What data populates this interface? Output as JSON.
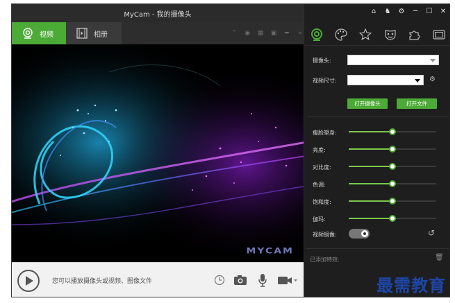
{
  "window": {
    "title": "MyCam - 我的摄像头"
  },
  "tabs": [
    {
      "label": "视频",
      "icon": "webcam-icon",
      "active": true
    },
    {
      "label": "相册",
      "icon": "film-icon",
      "active": false
    }
  ],
  "toolbar_icons": [
    "collapse-icon",
    "broadcast-icon",
    "grid-icon",
    "lock-icon",
    "share-icon",
    "chevron-left-icon"
  ],
  "preview": {
    "watermark": "MYCAM"
  },
  "bottom": {
    "hint": "您可以播放摄像头或视频、图像文件",
    "icons": [
      "play-icon",
      "timer-icon",
      "camera-icon",
      "microphone-icon",
      "video-camera-icon"
    ]
  },
  "window_controls": [
    "home-icon",
    "shirt-icon",
    "gear-icon",
    "minimize-icon",
    "maximize-icon",
    "close-icon"
  ],
  "feature_tabs": [
    "webcam-tab-icon",
    "palette-icon",
    "star-effects-icon",
    "mask-icon",
    "puzzle-icon",
    "frame-icon"
  ],
  "settings": {
    "camera_label": "摄像头:",
    "camera_value": "",
    "size_label": "视频尺寸:",
    "size_value": "",
    "open_camera": "打开摄像头",
    "open_file": "打开文件"
  },
  "adjustments": [
    {
      "label": "瘦脸塑身:",
      "value": 0.5
    },
    {
      "label": "亮度:",
      "value": 0.5
    },
    {
      "label": "对比度:",
      "value": 0.5
    },
    {
      "label": "色调:",
      "value": 0.5
    },
    {
      "label": "饱和度:",
      "value": 0.5
    },
    {
      "label": "伽玛:",
      "value": 0.5
    }
  ],
  "mirror": {
    "label": "视频镜像:",
    "on": true
  },
  "effects": {
    "label": "已添加特效:"
  },
  "brand": "最需教育",
  "colors": {
    "accent": "#4caa36",
    "panel": "#1e1e1e",
    "slider": "#7cc84e"
  }
}
